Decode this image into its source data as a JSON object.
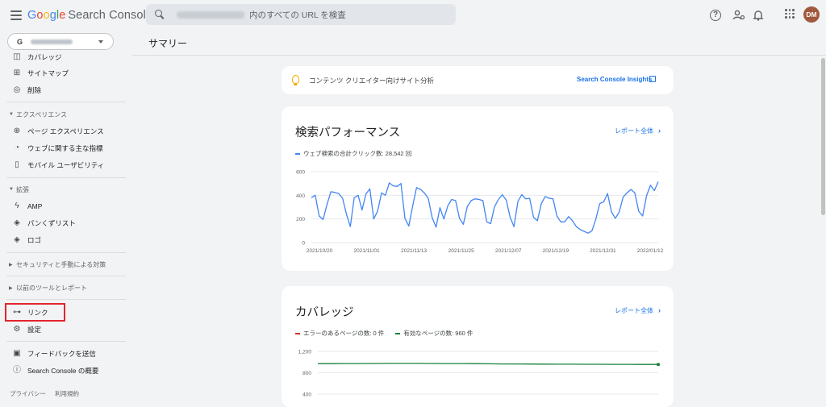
{
  "app": {
    "logo_google": [
      "G",
      "o",
      "o",
      "g",
      "l",
      "e"
    ],
    "logo_product": "Search Console",
    "search_placeholder": "内のすべての URL を検査",
    "avatar_initials": "DM",
    "property_glyph": "G"
  },
  "sidebar": {
    "items_top": [
      {
        "label": "カバレッジ",
        "icon": "coverage-icon"
      },
      {
        "label": "サイトマップ",
        "icon": "sitemap-icon"
      },
      {
        "label": "削除",
        "icon": "removal-icon"
      }
    ],
    "section_experience": "エクスペリエンス",
    "items_experience": [
      {
        "label": "ページ エクスペリエンス",
        "icon": "page-experience-icon"
      },
      {
        "label": "ウェブに関する主な指標",
        "icon": "web-vitals-icon"
      },
      {
        "label": "モバイル ユーザビリティ",
        "icon": "mobile-icon"
      }
    ],
    "section_enhancements": "拡張",
    "items_enhancements": [
      {
        "label": "AMP",
        "icon": "amp-icon"
      },
      {
        "label": "パンくずリスト",
        "icon": "breadcrumb-icon"
      },
      {
        "label": "ロゴ",
        "icon": "logo-icon"
      }
    ],
    "section_security": "セキュリティと手動による対策",
    "section_legacy": "以前のツールとレポート",
    "items_bottom": [
      {
        "label": "リンク",
        "icon": "links-icon"
      },
      {
        "label": "設定",
        "icon": "settings-icon"
      }
    ],
    "items_footer_nav": [
      {
        "label": "フィードバックを送信",
        "icon": "feedback-icon"
      },
      {
        "label": "Search Console の概要",
        "icon": "info-icon"
      }
    ],
    "footer_links": [
      "プライバシー",
      "利用規約"
    ]
  },
  "main": {
    "page_title": "サマリー",
    "insight_text": "コンテンツ クリエイター向けサイト分析",
    "insight_link": "Search Console Insights",
    "performance": {
      "title": "検索パフォーマンス",
      "report_link": "レポート全体",
      "legend": "ウェブ検索の合計クリック数: 28,542 回",
      "color": "#4285f4"
    },
    "coverage": {
      "title": "カバレッジ",
      "report_link": "レポート全体",
      "legend_error": "エラーのあるページの数: 0 件",
      "legend_valid": "有効なページの数: 960 件",
      "color_error": "#d93025",
      "color_valid": "#188038"
    }
  },
  "chart_data": [
    {
      "type": "line",
      "title": "検索パフォーマンス",
      "ylim": [
        0,
        600
      ],
      "yticks": [
        0,
        200,
        400,
        600
      ],
      "xticks": [
        "2021/10/20",
        "2021/11/01",
        "2021/11/13",
        "2021/11/25",
        "2021/12/07",
        "2021/12/19",
        "2021/12/31",
        "2022/01/12"
      ],
      "series": [
        {
          "name": "ウェブ検索の合計クリック数: 28,542 回",
          "values": [
            380,
            400,
            225,
            195,
            320,
            430,
            425,
            415,
            375,
            240,
            135,
            380,
            400,
            275,
            410,
            455,
            200,
            265,
            420,
            400,
            505,
            480,
            475,
            500,
            205,
            140,
            310,
            465,
            450,
            420,
            375,
            210,
            130,
            295,
            200,
            310,
            365,
            355,
            205,
            155,
            305,
            355,
            370,
            365,
            355,
            175,
            160,
            305,
            365,
            405,
            360,
            215,
            135,
            350,
            405,
            370,
            375,
            215,
            185,
            330,
            390,
            375,
            370,
            225,
            175,
            175,
            220,
            185,
            135,
            110,
            95,
            80,
            100,
            200,
            330,
            345,
            415,
            260,
            205,
            260,
            385,
            420,
            450,
            420,
            265,
            225,
            395,
            485,
            440,
            515
          ]
        }
      ]
    },
    {
      "type": "line",
      "title": "カバレッジ",
      "ylim": [
        400,
        1200
      ],
      "yticks": [
        400,
        800,
        1200
      ],
      "series": [
        {
          "name": "有効なページの数: 960 件",
          "values": [
            970,
            970,
            972,
            972,
            973,
            975,
            975,
            975,
            973,
            972,
            972,
            970,
            968,
            965,
            965,
            963,
            962,
            960,
            960,
            958,
            958,
            957,
            957,
            956,
            955
          ]
        }
      ]
    }
  ]
}
